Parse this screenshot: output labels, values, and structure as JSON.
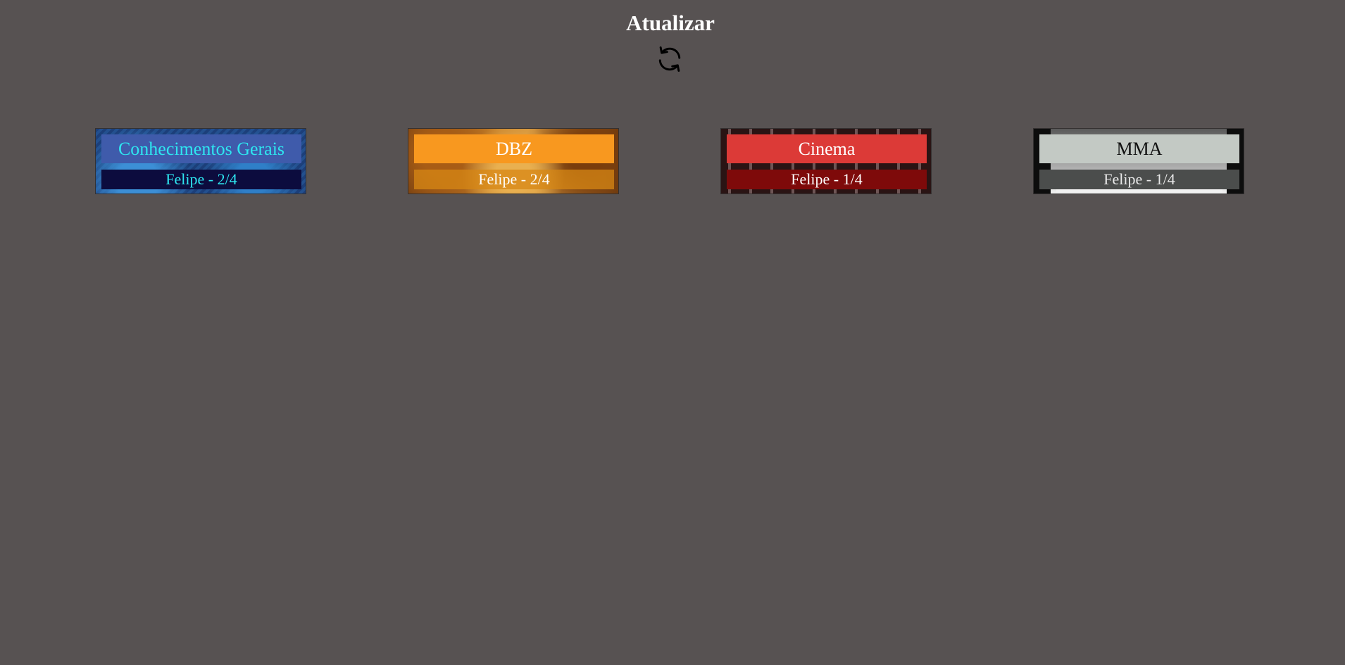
{
  "header": {
    "title": "Atualizar",
    "refresh_icon": "refresh-icon"
  },
  "cards": [
    {
      "title": "Conhecimentos Gerais",
      "subtitle": "Felipe - 2/4",
      "accent": "#3f5bab",
      "text_color": "#2ee6f0"
    },
    {
      "title": "DBZ",
      "subtitle": "Felipe - 2/4",
      "accent": "#f8981f",
      "text_color": "#ffffff"
    },
    {
      "title": "Cinema",
      "subtitle": "Felipe - 1/4",
      "accent": "#dc3a37",
      "text_color": "#ffffff"
    },
    {
      "title": "MMA",
      "subtitle": "Felipe - 1/4",
      "accent": "#c3c9c4",
      "text_color": "#111111"
    }
  ],
  "colors": {
    "background": "#575252"
  }
}
